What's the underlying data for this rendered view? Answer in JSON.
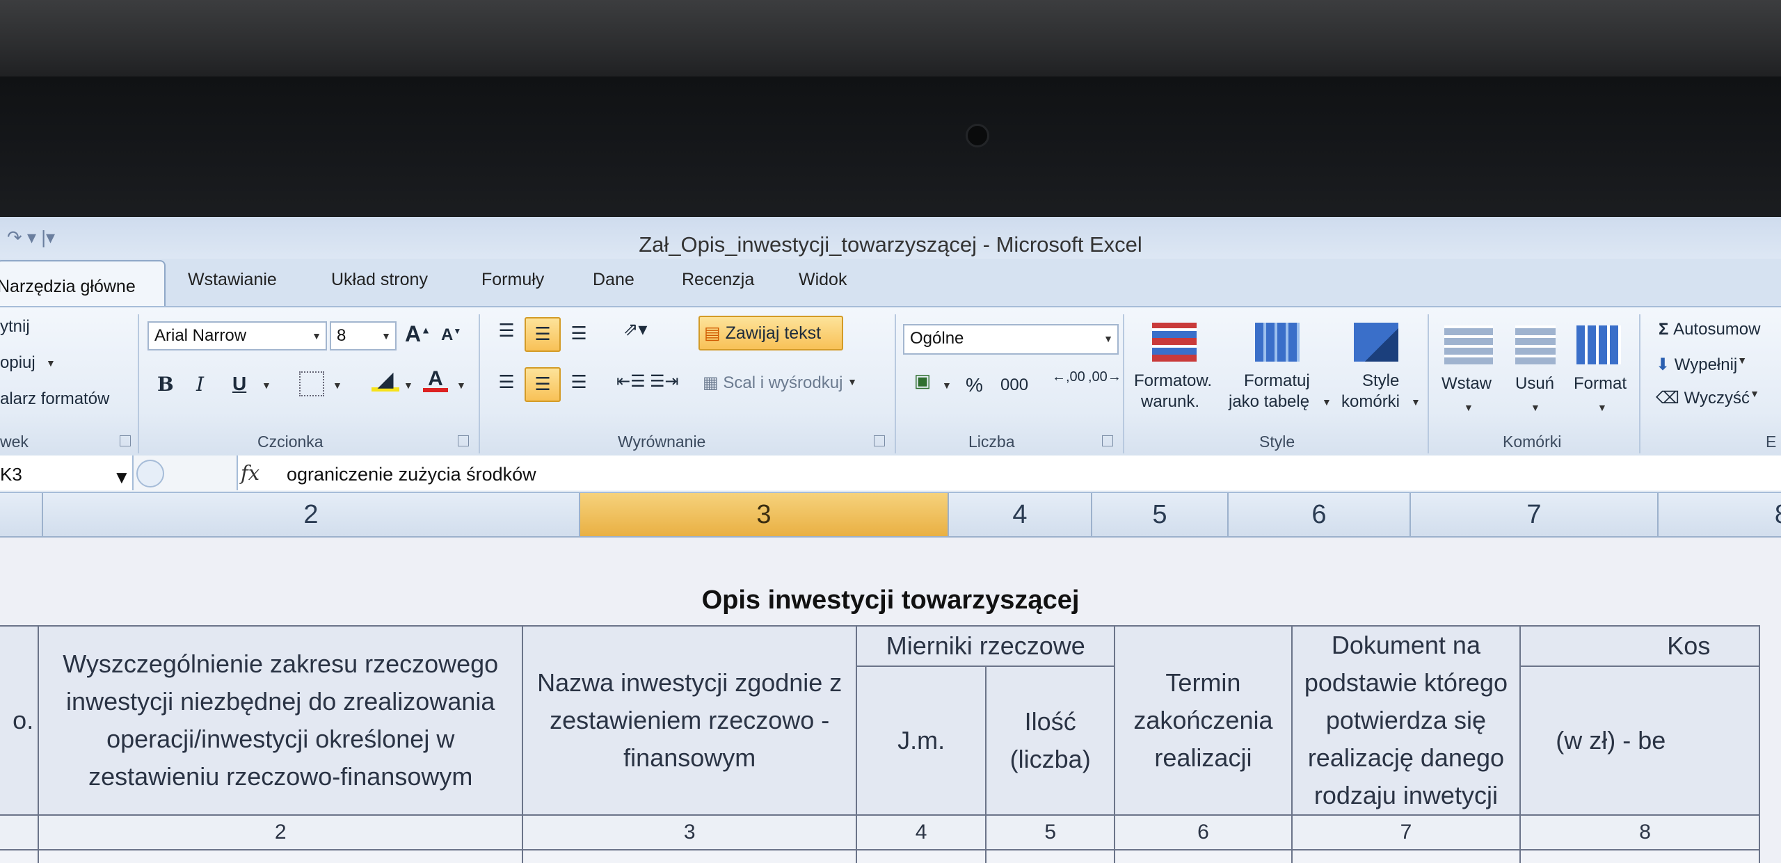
{
  "window": {
    "title": "Zał_Opis_inwestycji_towarzyszącej  -  Microsoft Excel"
  },
  "tabs": [
    {
      "label": "Narzędzia główne",
      "active": true
    },
    {
      "label": "Wstawianie"
    },
    {
      "label": "Układ strony"
    },
    {
      "label": "Formuły"
    },
    {
      "label": "Dane"
    },
    {
      "label": "Recenzja"
    },
    {
      "label": "Widok"
    }
  ],
  "ribbon": {
    "clipboard": {
      "cut": "ytnij",
      "copy": "opiuj",
      "painter": "alarz formatów",
      "label": "wek"
    },
    "font": {
      "name": "Arial Narrow",
      "size": "8",
      "label": "Czcionka",
      "bold": "B",
      "italic": "I",
      "underline": "U",
      "grow": "A",
      "shrink": "A",
      "color_letter": "A"
    },
    "alignment": {
      "wrap": "Zawijaj tekst",
      "merge": "Scal i wyśrodkuj",
      "label": "Wyrównanie"
    },
    "number": {
      "format": "Ogólne",
      "percent": "%",
      "thousands": "000",
      "inc": ",00",
      "dec": ",00",
      "label": "Liczba"
    },
    "styles": {
      "conditional": "Formatow.",
      "conditional2": "warunk.",
      "table": "Formatuj",
      "table2": "jako tabelę",
      "cell": "Style",
      "cell2": "komórki",
      "label": "Style"
    },
    "cells": {
      "insert": "Wstaw",
      "delete": "Usuń",
      "format": "Format",
      "label": "Komórki"
    },
    "editing": {
      "autosum": "Autosumow",
      "fill": "Wypełnij",
      "clear": "Wyczyść",
      "label": "E"
    }
  },
  "formula_bar": {
    "name_box": "K3",
    "fx": "fx",
    "content": "ograniczenie zużycia środków"
  },
  "column_headers": [
    "2",
    "3",
    "4",
    "5",
    "6",
    "7",
    "8"
  ],
  "sheet": {
    "title": "Opis inwestycji towarzyszącej",
    "headers": {
      "lp": "o.",
      "zakres": "Wyszczególnienie zakresu rzeczowego inwestycji niezbędnej do zrealizowania operacji/inwestycji określonej w zestawieniu rzeczowo-finansowym",
      "nazwa": "Nazwa inwestycji zgodnie z zestawieniem rzeczowo - finansowym",
      "mierniki": "Mierniki rzeczowe",
      "jm": "J.m.",
      "ilosc": "Ilość (liczba)",
      "termin": "Termin zakończenia realizacji",
      "dokument": "Dokument na podstawie którego potwierdza się realizację danego rodzaju inwetycji",
      "koszt": "Kos",
      "koszt_sub": "(w zł) - be"
    },
    "numbers": [
      "2",
      "3",
      "4",
      "5",
      "6",
      "7",
      "8"
    ]
  }
}
